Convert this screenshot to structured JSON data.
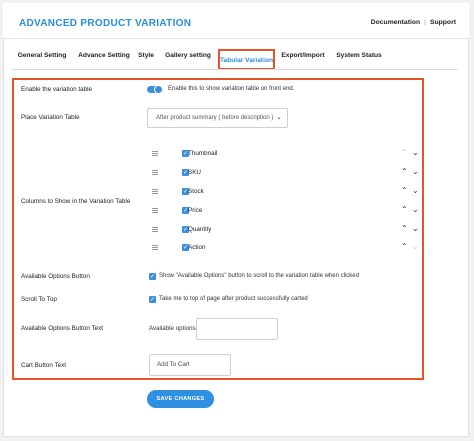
{
  "header": {
    "title": "ADVANCED PRODUCT VARIATION",
    "links": [
      "Documentation",
      "Support"
    ],
    "separator": "|"
  },
  "tabs": [
    {
      "label": "General Setting",
      "active": false
    },
    {
      "label": "Advance Setting",
      "active": false
    },
    {
      "label": "Style",
      "active": false
    },
    {
      "label": "Gallery setting",
      "active": false
    },
    {
      "label": "Tabular Variation",
      "active": true
    },
    {
      "label": "Export/Import",
      "active": false
    },
    {
      "label": "System Status",
      "active": false
    }
  ],
  "settings": {
    "enable": {
      "label": "Enable the variation table",
      "helper": "Enable this to show variation table on front end.",
      "enabled": true
    },
    "place": {
      "label": "Place Variation Table",
      "value": "After product summary ( before description )"
    },
    "columns": {
      "label": "Columns to Show in the Variation Table",
      "items": [
        {
          "name": "Thumbnail",
          "checked": true
        },
        {
          "name": "SKU",
          "checked": true
        },
        {
          "name": "Stock",
          "checked": true
        },
        {
          "name": "Price",
          "checked": true
        },
        {
          "name": "Quantity",
          "checked": true
        },
        {
          "name": "Action",
          "checked": true
        }
      ]
    },
    "available_options_button": {
      "label": "Available Options Button",
      "helper": "Show \"Available Options\" button to scroll to the variation table when clicked",
      "checked": true
    },
    "scroll_to_top": {
      "label": "Scroll To Top",
      "helper": "Take me to top of page after product successfully carted",
      "checked": true
    },
    "available_options_text": {
      "label": "Available Options Button Text",
      "value": "Available options",
      "placeholder": ""
    },
    "cart_button_text": {
      "label": "Cart Button Text",
      "value": "Add To Cart"
    }
  },
  "save_button": "SAVE CHANGES",
  "colors": {
    "accent": "#2a8fd8",
    "highlight": "#e4552a",
    "button": "#2f8fe0"
  }
}
